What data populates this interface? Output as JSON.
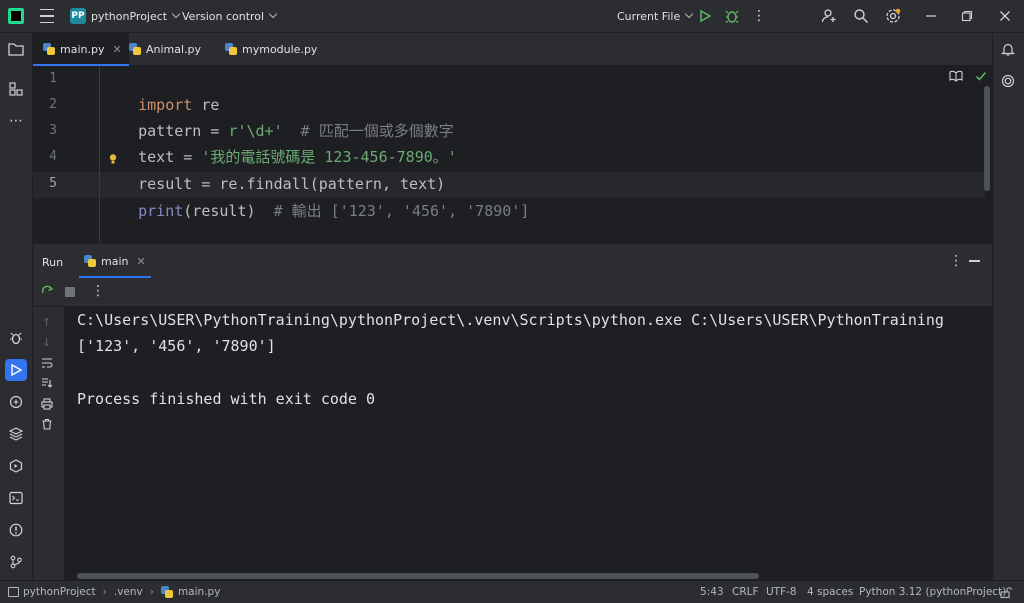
{
  "titlebar": {
    "project_badge": "PP",
    "project_name": "pythonProject",
    "version_control": "Version control",
    "run_config": "Current File"
  },
  "tabs": [
    {
      "label": "main.py",
      "active": true
    },
    {
      "label": "Animal.py",
      "active": false
    },
    {
      "label": "mymodule.py",
      "active": false
    }
  ],
  "editor": {
    "line_numbers": [
      "1",
      "2",
      "3",
      "4",
      "5"
    ],
    "current_line": 5,
    "lines": [
      {
        "kw": "import",
        "rest": " re"
      },
      {
        "pre": "pattern = ",
        "str": "r'\\d+'",
        "cmt": "  # 匹配一個或多個數字"
      },
      {
        "pre": "text = ",
        "str": "'我的電話號碼是 123-456-7890。'"
      },
      {
        "pre": "result = re.findall(pattern, text)"
      },
      {
        "builtin": "print",
        "pre": "(result)",
        "cmt": "  # 輸出 ['123', '456', '7890']"
      }
    ]
  },
  "run_panel": {
    "title": "Run",
    "tab_label": "main",
    "output": [
      "C:\\Users\\USER\\PythonTraining\\pythonProject\\.venv\\Scripts\\python.exe C:\\Users\\USER\\PythonTraining",
      "['123', '456', '7890']",
      "",
      "Process finished with exit code 0"
    ]
  },
  "statusbar": {
    "breadcrumb": [
      "pythonProject",
      ".venv",
      "main.py"
    ],
    "position": "5:43",
    "line_ending": "CRLF",
    "encoding": "UTF-8",
    "indent": "4 spaces",
    "interpreter": "Python 3.12 (pythonProject)"
  },
  "colors": {
    "accent": "#3574f0",
    "keyword": "#cf8e6d",
    "string": "#6aab73",
    "comment": "#7a7e85",
    "builtin": "#8888c6"
  }
}
